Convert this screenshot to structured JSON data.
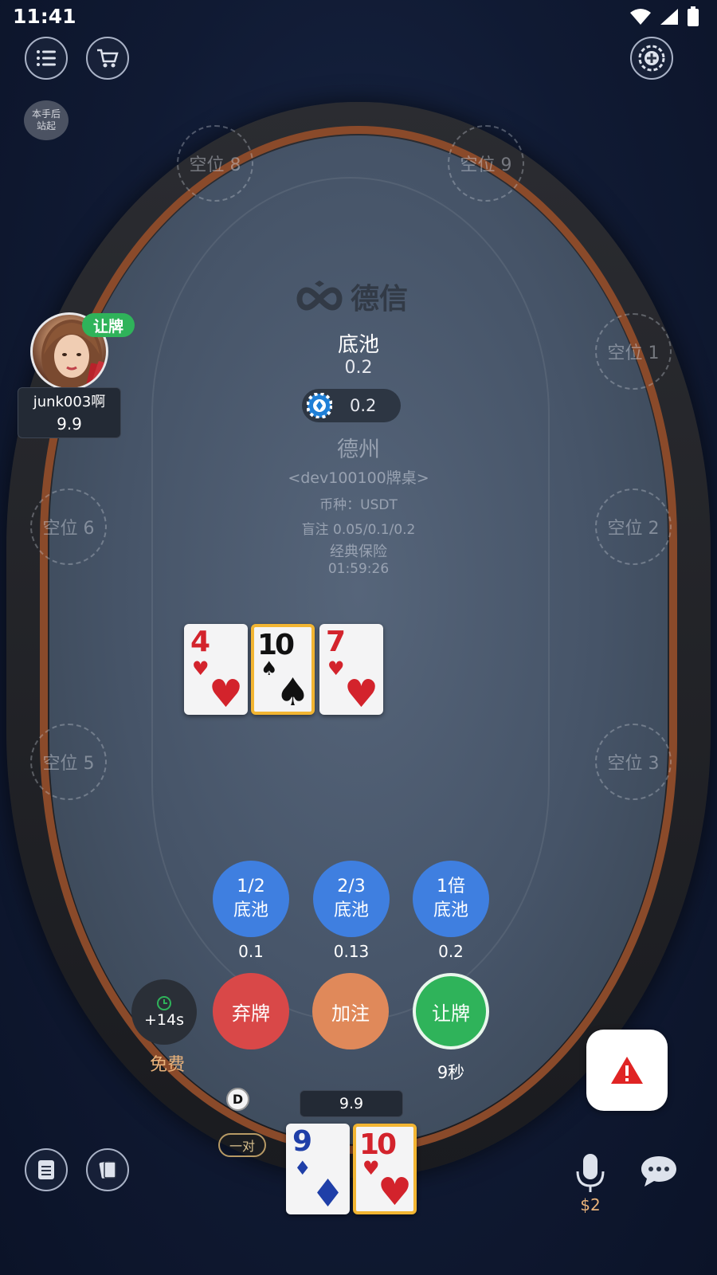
{
  "status_bar": {
    "time": "11:41"
  },
  "seats": {
    "seat1": "空位 1",
    "seat2": "空位 2",
    "seat3": "空位 3",
    "seat5": "空位 5",
    "seat6": "空位 6",
    "seat8": "空位 8",
    "seat9": "空位 9"
  },
  "stand_up": {
    "line1": "本手后",
    "line2": "站起"
  },
  "table": {
    "logo_text": "德信",
    "pot_label": "底池",
    "pot_value": "0.2",
    "pot_chip_value": "0.2",
    "game_name": "德州",
    "table_name": "<dev100100牌桌>",
    "currency": "币种：USDT",
    "blinds": "盲注 0.05/0.1/0.2",
    "insurance": "经典保险",
    "clock": "01:59:26"
  },
  "community_cards": [
    {
      "rank": "4",
      "suit": "♥",
      "color": "red",
      "highlight": false
    },
    {
      "rank": "10",
      "suit": "♠",
      "color": "black",
      "highlight": true
    },
    {
      "rank": "7",
      "suit": "♥",
      "color": "red",
      "highlight": false
    }
  ],
  "player": {
    "name": "junk003啊",
    "stack": "9.9",
    "action_badge": "让牌"
  },
  "pot_buttons": [
    {
      "line1": "1/2",
      "line2": "底池",
      "amount": "0.1"
    },
    {
      "line1": "2/3",
      "line2": "底池",
      "amount": "0.13"
    },
    {
      "line1": "1倍",
      "line2": "底池",
      "amount": "0.2"
    }
  ],
  "actions": {
    "timer_add": "+14s",
    "free_label": "免费",
    "fold": "弃牌",
    "raise": "加注",
    "check": "让牌",
    "countdown": "9秒"
  },
  "hero": {
    "dealer": "D",
    "hand_type": "一对",
    "stack": "9.9",
    "cards": [
      {
        "rank": "9",
        "suit": "♦",
        "color": "blue",
        "highlight": false
      },
      {
        "rank": "10",
        "suit": "♥",
        "color": "red",
        "highlight": true
      }
    ]
  },
  "bottom": {
    "mic_price": "$2"
  },
  "colors": {
    "pot_button": "#3f7fe0",
    "fold": "#d94848",
    "raise": "#e0895a",
    "check": "#2fb35a",
    "highlight": "#f2b532"
  }
}
